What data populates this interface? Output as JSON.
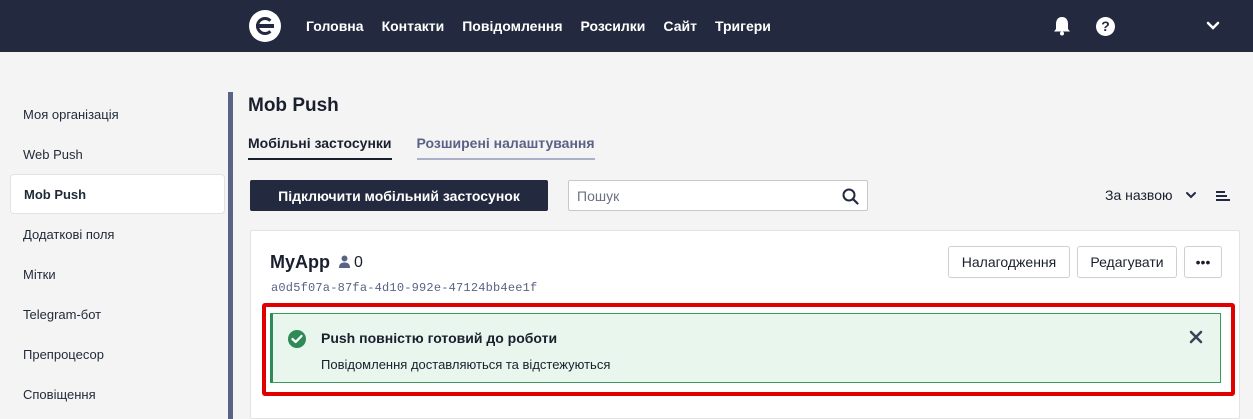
{
  "nav": {
    "items": [
      "Головна",
      "Контакти",
      "Повідомлення",
      "Розсилки",
      "Сайт",
      "Тригери"
    ],
    "help_label": "?"
  },
  "sidebar": {
    "items": [
      "Моя організація",
      "Web Push",
      "Mob Push",
      "Додаткові поля",
      "Мітки",
      "Telegram-бот",
      "Препроцесор",
      "Сповіщення"
    ],
    "active": "Mob Push"
  },
  "page": {
    "title": "Mob Push",
    "tabs": [
      "Мобільні застосунки",
      "Розширені налаштування"
    ]
  },
  "toolbar": {
    "connect_label": "Підключити мобільний застосунок",
    "search_placeholder": "Пошук",
    "sort_label": "За назвою"
  },
  "app": {
    "name": "MyApp",
    "users": "0",
    "id": "a0d5f07a-87fa-4d10-992e-47124bb4ee1f",
    "debug_label": "Налагодження",
    "edit_label": "Редагувати",
    "more_label": "•••"
  },
  "alert": {
    "title": "Push повністю готовий до роботи",
    "text": "Повідомлення доставляються та відстежуються"
  },
  "colors": {
    "topbar": "#232a3f",
    "success": "#2e8b57",
    "highlight": "#e00000"
  }
}
